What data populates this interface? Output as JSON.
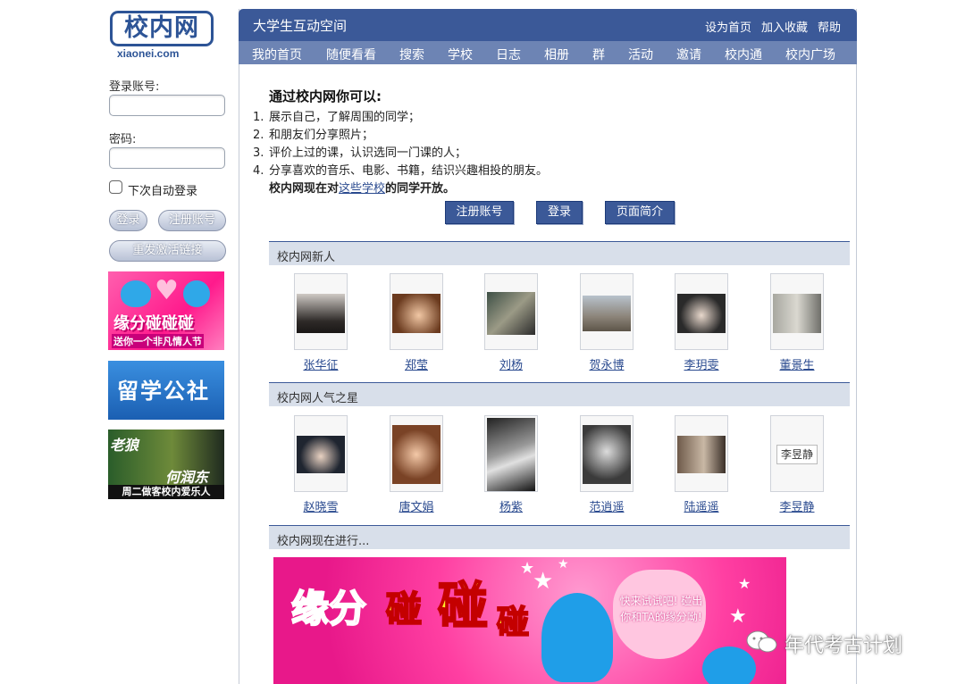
{
  "logo": {
    "text": "校内网",
    "sub": "xiaonei.com"
  },
  "login": {
    "account_label": "登录账号:",
    "password_label": "密码:",
    "remember_label": "下次自动登录",
    "login_button": "登录",
    "register_button": "注册账号",
    "resend_button": "重发激活链接"
  },
  "side_ads": {
    "ad1_line1": "缘分碰碰碰",
    "ad1_line2": "送你一个非凡情人节",
    "ad2": "留学公社",
    "ad3_line1": "老狼",
    "ad3_line2": "何润东",
    "ad3_line3": "周二做客校内爱乐人"
  },
  "header": {
    "site_title": "大学生互动空间",
    "links": [
      "设为首页",
      "加入收藏",
      "帮助"
    ]
  },
  "nav": [
    "我的首页",
    "随便看看",
    "搜索",
    "学校",
    "日志",
    "相册",
    "群",
    "活动",
    "邀请",
    "校内通",
    "校内广场"
  ],
  "intro": {
    "title": "通过校内网你可以:",
    "items": [
      {
        "n": "1.",
        "text": "展示自己，了解周围的同学；"
      },
      {
        "n": "2.",
        "text": "和朋友们分享照片；"
      },
      {
        "n": "3.",
        "text": "评价上过的课，认识选同一门课的人；"
      },
      {
        "n": "4.",
        "text": "分享喜欢的音乐、电影、书籍，结识兴趣相投的朋友。"
      }
    ],
    "foot_before": "校内网现在对",
    "foot_link": "这些学校",
    "foot_after": "的同学开放。"
  },
  "actions": [
    "注册账号",
    "登录",
    "页面简介"
  ],
  "sections": {
    "new_users": {
      "title": "校内网新人",
      "people": [
        "张华征",
        "郑莹",
        "刘杨",
        "贺永博",
        "李玥雯",
        "董景生"
      ]
    },
    "popular": {
      "title": "校内网人气之星",
      "people": [
        "赵晓雪",
        "唐文娟",
        "杨紫",
        "范逍遥",
        "陆遥遥",
        "李昱静"
      ],
      "missing_photo_alt": "李昱静"
    },
    "now": {
      "title": "校内网现在进行..."
    }
  },
  "banner": {
    "t1": "缘分",
    "t2": "碰",
    "t3": "碰",
    "t4": "碰",
    "heart_text": "快来试试吧! 碰出你和TA的缘分呦!"
  },
  "watermark": {
    "text": "年代考古计划"
  },
  "colors": {
    "brand": "#3b5998",
    "nav": "#6d84b4",
    "section": "#d8dfea"
  }
}
